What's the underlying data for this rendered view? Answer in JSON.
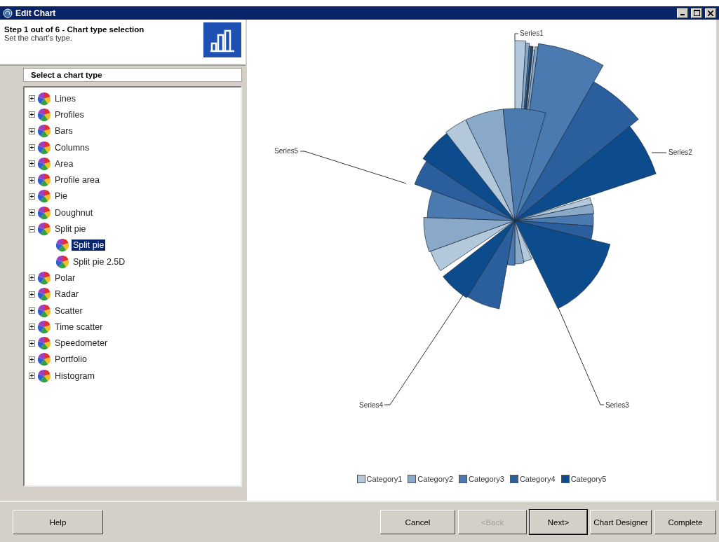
{
  "window": {
    "title": "Edit Chart"
  },
  "header": {
    "title": "Step 1 out of 6 - Chart type selection",
    "subtitle": "Set the chart's type."
  },
  "chart_type_panel": {
    "title": "Select a chart type",
    "tree": [
      {
        "label": "Lines",
        "expanded": false,
        "selected": false
      },
      {
        "label": "Profiles",
        "expanded": false,
        "selected": false
      },
      {
        "label": "Bars",
        "expanded": false,
        "selected": false
      },
      {
        "label": "Columns",
        "expanded": false,
        "selected": false
      },
      {
        "label": "Area",
        "expanded": false,
        "selected": false
      },
      {
        "label": "Profile area",
        "expanded": false,
        "selected": false
      },
      {
        "label": "Pie",
        "expanded": false,
        "selected": false
      },
      {
        "label": "Doughnut",
        "expanded": false,
        "selected": false
      },
      {
        "label": "Split pie",
        "expanded": true,
        "selected": false,
        "children": [
          {
            "label": "Split pie",
            "selected": true
          },
          {
            "label": "Split pie 2.5D",
            "selected": false
          }
        ]
      },
      {
        "label": "Polar",
        "expanded": false,
        "selected": false
      },
      {
        "label": "Radar",
        "expanded": false,
        "selected": false
      },
      {
        "label": "Scatter",
        "expanded": false,
        "selected": false
      },
      {
        "label": "Time scatter",
        "expanded": false,
        "selected": false
      },
      {
        "label": "Speedometer",
        "expanded": false,
        "selected": false
      },
      {
        "label": "Portfolio",
        "expanded": false,
        "selected": false
      },
      {
        "label": "Histogram",
        "expanded": false,
        "selected": false
      }
    ]
  },
  "preview": {
    "series_labels": [
      "Series1",
      "Series2",
      "Series3",
      "Series4",
      "Series5"
    ],
    "legend": [
      {
        "label": "Category1",
        "color": "#b4c8dc"
      },
      {
        "label": "Category2",
        "color": "#8aa8c8"
      },
      {
        "label": "Category3",
        "color": "#4a7ab0"
      },
      {
        "label": "Category4",
        "color": "#2a5e9c"
      },
      {
        "label": "Category5",
        "color": "#0c4c8c"
      }
    ]
  },
  "buttons_left": [
    {
      "label": "Help",
      "disabled": false,
      "default": false
    }
  ],
  "buttons_right": [
    {
      "label": "Cancel",
      "disabled": false,
      "default": false
    },
    {
      "label": "<Back",
      "disabled": true,
      "default": false
    },
    {
      "label": "Next>",
      "disabled": false,
      "default": true
    },
    {
      "label": "Chart Designer",
      "disabled": false,
      "default": false
    },
    {
      "label": "Complete",
      "disabled": false,
      "default": false
    }
  ]
}
